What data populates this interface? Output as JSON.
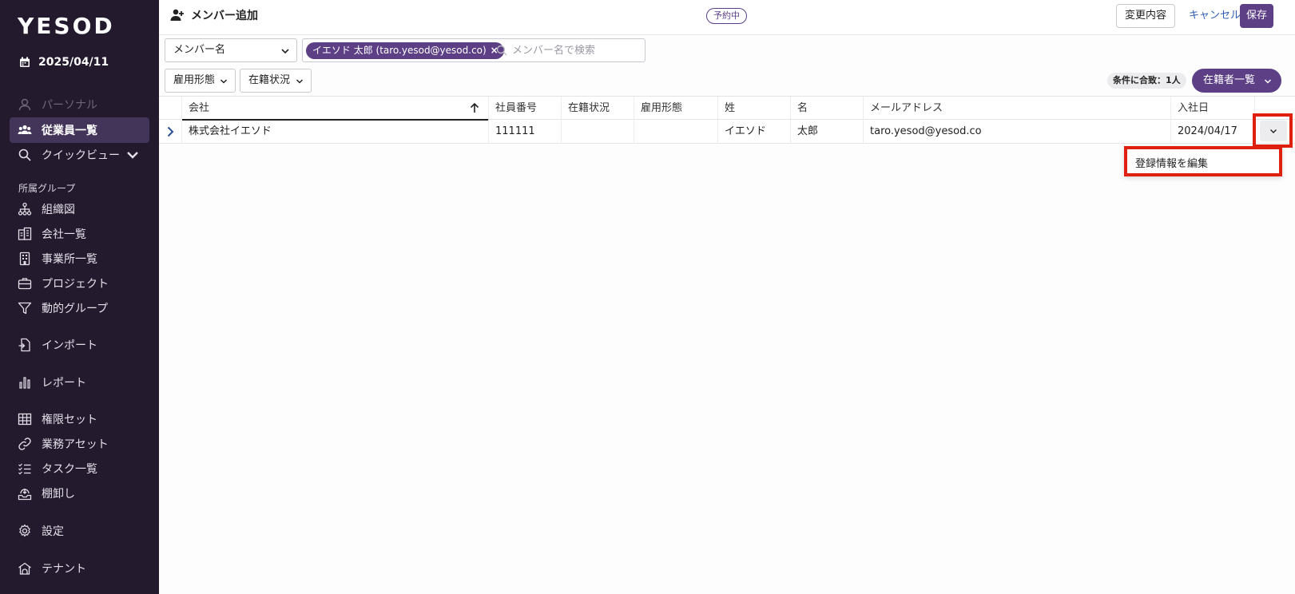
{
  "sidebar": {
    "logo": "YESOD",
    "date": "2025/04/11",
    "items": [
      {
        "label": "パーソナル",
        "icon": "person-icon"
      },
      {
        "label": "従業員一覧",
        "icon": "people-icon"
      },
      {
        "label": "クイックビュー",
        "icon": "search-icon"
      }
    ],
    "section_label": "所属グループ",
    "group_items": [
      {
        "label": "組織図",
        "icon": "org-chart-icon"
      },
      {
        "label": "会社一覧",
        "icon": "building-icon"
      },
      {
        "label": "事業所一覧",
        "icon": "office-icon"
      },
      {
        "label": "プロジェクト",
        "icon": "briefcase-icon"
      },
      {
        "label": "動的グループ",
        "icon": "filter-icon"
      }
    ],
    "other_items": [
      {
        "label": "インポート",
        "icon": "import-icon"
      },
      {
        "label": "レポート",
        "icon": "bar-chart-icon"
      },
      {
        "label": "権限セット",
        "icon": "grid-icon"
      },
      {
        "label": "業務アセット",
        "icon": "link-icon"
      },
      {
        "label": "タスク一覧",
        "icon": "checklist-icon"
      },
      {
        "label": "棚卸し",
        "icon": "inventory-icon"
      },
      {
        "label": "設定",
        "icon": "gear-icon"
      },
      {
        "label": "テナント",
        "icon": "tenant-icon"
      }
    ]
  },
  "header": {
    "title": "メンバー追加",
    "status": "予約中",
    "changes_label": "変更内容",
    "cancel_label": "キャンセル",
    "save_label": "保存"
  },
  "filters": {
    "field_select": "メンバー名",
    "chip": "イエソド 太郎 (taro.yesod@yesod.co)",
    "search_placeholder": "メンバー名で検索",
    "employment_type": "雇用形態",
    "enrollment_status": "在籍状況",
    "count": "条件に合致：1人",
    "roster_label": "在籍者一覧"
  },
  "table": {
    "columns": [
      "会社",
      "社員番号",
      "在籍状況",
      "雇用形態",
      "姓",
      "名",
      "メールアドレス",
      "入社日"
    ],
    "rows": [
      [
        "株式会社イエソド",
        "111111",
        "",
        "",
        "イエソド",
        "太郎",
        "taro.yesod@yesod.co",
        "2024/04/17"
      ]
    ]
  },
  "row_menu": {
    "edit_label": "登録情報を編集"
  },
  "colors": {
    "sidebar_bg": "#231a2e",
    "accent": "#5d3f86",
    "highlight": "#e0200f"
  }
}
